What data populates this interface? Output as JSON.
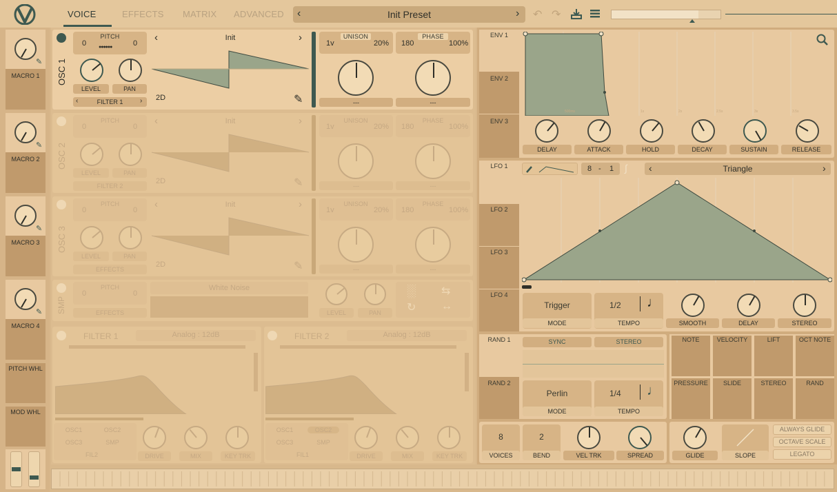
{
  "topbar": {
    "tabs": [
      "VOICE",
      "EFFECTS",
      "MATRIX",
      "ADVANCED"
    ],
    "preset_name": "Init Preset",
    "volume": 0.8
  },
  "macros": [
    {
      "label": "MACRO 1"
    },
    {
      "label": "MACRO 2"
    },
    {
      "label": "MACRO 3"
    },
    {
      "label": "MACRO 4"
    }
  ],
  "wheels": {
    "pitch": "PITCH WHL",
    "mod": "MOD WHL"
  },
  "oscillators": [
    {
      "label": "OSC 1",
      "pitch_label": "PITCH",
      "pitch_left": "0",
      "pitch_right": "0",
      "wave": "Init",
      "dim": "2D",
      "unison_label": "UNISON",
      "voices": "1v",
      "detune": "20%",
      "phase_label": "PHASE",
      "phase": "180",
      "phase_rand": "100%",
      "level": "LEVEL",
      "pan": "PAN",
      "dest": "FILTER 1",
      "uni_mode": "---",
      "phase_mode": "---"
    },
    {
      "label": "OSC 2",
      "pitch_label": "PITCH",
      "pitch_left": "0",
      "pitch_right": "0",
      "wave": "Init",
      "dim": "2D",
      "unison_label": "UNISON",
      "voices": "1v",
      "detune": "20%",
      "phase_label": "PHASE",
      "phase": "180",
      "phase_rand": "100%",
      "level": "LEVEL",
      "pan": "PAN",
      "dest": "FILTER 2",
      "uni_mode": "---",
      "phase_mode": "---"
    },
    {
      "label": "OSC 3",
      "pitch_label": "PITCH",
      "pitch_left": "0",
      "pitch_right": "0",
      "wave": "Init",
      "dim": "2D",
      "unison_label": "UNISON",
      "voices": "1v",
      "detune": "20%",
      "phase_label": "PHASE",
      "phase": "180",
      "phase_rand": "100%",
      "level": "LEVEL",
      "pan": "PAN",
      "dest": "EFFECTS",
      "uni_mode": "---",
      "phase_mode": "---"
    }
  ],
  "sampler": {
    "label": "SMP",
    "pitch_label": "PITCH",
    "pitch_left": "0",
    "pitch_right": "0",
    "sample": "White Noise",
    "dest": "EFFECTS",
    "level": "LEVEL",
    "pan": "PAN"
  },
  "filters": [
    {
      "label": "FILTER 1",
      "type": "Analog : 12dB",
      "sources": [
        "OSC1",
        "OSC2",
        "OSC3",
        "SMP",
        "FIL2"
      ],
      "knobs": [
        "DRIVE",
        "MIX",
        "KEY TRK"
      ]
    },
    {
      "label": "FILTER 2",
      "type": "Analog : 12dB",
      "sources": [
        "OSC1",
        "OSC2",
        "OSC3",
        "SMP",
        "FIL1"
      ],
      "knobs": [
        "DRIVE",
        "MIX",
        "KEY TRK"
      ]
    }
  ],
  "envelopes": {
    "tabs": [
      "ENV 1",
      "ENV 2",
      "ENV 3"
    ],
    "knobs": [
      "DELAY",
      "ATTACK",
      "HOLD",
      "DECAY",
      "SUSTAIN",
      "RELEASE"
    ],
    "time_marks": [
      "500ms",
      "1s",
      "2s",
      "2.5s",
      "3s",
      "3.5s"
    ]
  },
  "lfos": {
    "tabs": [
      "LFO 1",
      "LFO 2",
      "LFO 3",
      "LFO 4"
    ],
    "grid_a": "8",
    "grid_sep": "-",
    "grid_b": "1",
    "shape": "Triangle",
    "mode_value": "Trigger",
    "mode_label": "MODE",
    "tempo_value": "1/2",
    "tempo_label": "TEMPO",
    "knobs": [
      "SMOOTH",
      "DELAY",
      "STEREO"
    ]
  },
  "random": {
    "tabs": [
      "RAND 1",
      "RAND 2"
    ],
    "sync": "SYNC",
    "stereo": "STEREO",
    "mode_value": "Perlin",
    "mode_label": "MODE",
    "tempo_value": "1/4",
    "tempo_label": "TEMPO"
  },
  "mod_sources": [
    "NOTE",
    "VELOCITY",
    "LIFT",
    "OCT NOTE",
    "PRESSURE",
    "SLIDE",
    "STEREO",
    "RAND"
  ],
  "voice": {
    "voices_value": "8",
    "voices_label": "VOICES",
    "bend_value": "2",
    "bend_label": "BEND",
    "vel_trk": "VEL TRK",
    "spread": "SPREAD"
  },
  "glide": {
    "glide": "GLIDE",
    "slope": "SLOPE",
    "options": [
      "ALWAYS GLIDE",
      "OCTAVE SCALE",
      "LEGATO"
    ]
  }
}
